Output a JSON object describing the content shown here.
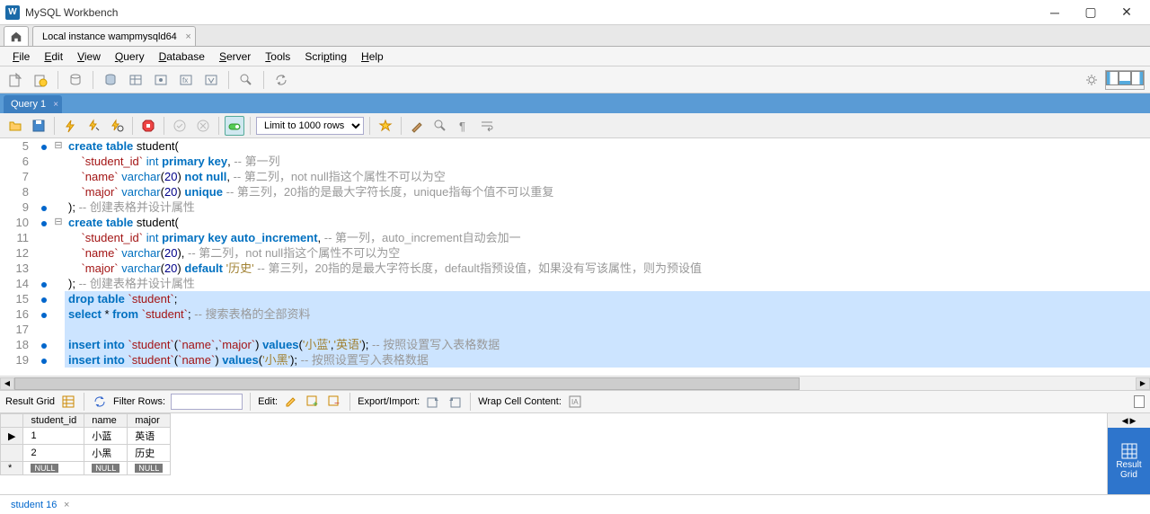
{
  "title": "MySQL Workbench",
  "connection_tab": "Local instance wampmysqld64",
  "menus": [
    "File",
    "Edit",
    "View",
    "Query",
    "Database",
    "Server",
    "Tools",
    "Scripting",
    "Help"
  ],
  "query_tab": "Query 1",
  "limit_label": "Limit to 1000 rows",
  "code": [
    {
      "n": 5,
      "marker": true,
      "fold": "⊟",
      "sel": false,
      "html": "<span class='kw'>create</span> <span class='kw'>table</span> student("
    },
    {
      "n": 6,
      "marker": false,
      "fold": "",
      "sel": false,
      "html": "    <span class='id'>`student_id`</span> <span class='fn'>int</span> <span class='kw'>primary key</span>, <span class='cmt'>-- 第一列</span>"
    },
    {
      "n": 7,
      "marker": false,
      "fold": "",
      "sel": false,
      "html": "    <span class='id'>`name`</span> <span class='fn'>varchar</span>(<span class='num'>20</span>) <span class='kw'>not null</span>, <span class='cmt'>-- 第二列，not null指这个属性不可以为空</span>"
    },
    {
      "n": 8,
      "marker": false,
      "fold": "",
      "sel": false,
      "html": "    <span class='id'>`major`</span> <span class='fn'>varchar</span>(<span class='num'>20</span>) <span class='kw'>unique</span> <span class='cmt'>-- 第三列，20指的是最大字符长度，unique指每个值不可以重复</span>"
    },
    {
      "n": 9,
      "marker": true,
      "fold": "",
      "sel": false,
      "html": "); <span class='cmt'>-- 创建表格并设计属性</span>"
    },
    {
      "n": 10,
      "marker": true,
      "fold": "⊟",
      "sel": false,
      "html": "<span class='kw'>create</span> <span class='kw'>table</span> student("
    },
    {
      "n": 11,
      "marker": false,
      "fold": "",
      "sel": false,
      "html": "    <span class='id'>`student_id`</span> <span class='fn'>int</span> <span class='kw'>primary key</span> <span class='kw'>auto_increment</span>, <span class='cmt'>-- 第一列，auto_increment自动会加一</span>"
    },
    {
      "n": 12,
      "marker": false,
      "fold": "",
      "sel": false,
      "html": "    <span class='id'>`name`</span> <span class='fn'>varchar</span>(<span class='num'>20</span>), <span class='cmt'>-- 第二列，not null指这个属性不可以为空</span>"
    },
    {
      "n": 13,
      "marker": false,
      "fold": "",
      "sel": false,
      "html": "    <span class='id'>`major`</span> <span class='fn'>varchar</span>(<span class='num'>20</span>) <span class='kw'>default</span> <span class='str'>'历史'</span> <span class='cmt'>-- 第三列，20指的是最大字符长度，default指预设值，如果没有写该属性，则为预设值</span>"
    },
    {
      "n": 14,
      "marker": true,
      "fold": "",
      "sel": false,
      "html": "); <span class='cmt'>-- 创建表格并设计属性</span>"
    },
    {
      "n": 15,
      "marker": true,
      "fold": "",
      "sel": true,
      "html": "<span class='kw'>drop</span> <span class='kw'>table</span> <span class='id'>`student`</span>;"
    },
    {
      "n": 16,
      "marker": true,
      "fold": "",
      "sel": true,
      "html": "<span class='kw'>select</span> * <span class='kw'>from</span> <span class='id'>`student`</span>; <span class='cmt'>-- 搜索表格的全部资料</span>"
    },
    {
      "n": 17,
      "marker": false,
      "fold": "",
      "sel": true,
      "html": " "
    },
    {
      "n": 18,
      "marker": true,
      "fold": "",
      "sel": true,
      "html": "<span class='kw'>insert into</span> <span class='id'>`student`</span>(<span class='id'>`name`</span>,<span class='id'>`major`</span>) <span class='kw'>values</span>(<span class='str'>'小蓝'</span>,<span class='str'>'英语'</span>); <span class='cmt'>-- 按照设置写入表格数据</span>"
    },
    {
      "n": 19,
      "marker": true,
      "fold": "",
      "sel": true,
      "html": "<span class='kw'>insert into</span> <span class='id'>`student`</span>(<span class='id'>`name`</span>) <span class='kw'>values</span>(<span class='str'>'小黑'</span>); <span class='cmt'>-- 按照设置写入表格数据</span>"
    }
  ],
  "result_toolbar": {
    "grid_label": "Result Grid",
    "filter_label": "Filter Rows:",
    "edit_label": "Edit:",
    "export_label": "Export/Import:",
    "wrap_label": "Wrap Cell Content:"
  },
  "result_side": "Result\nGrid",
  "grid": {
    "columns": [
      "student_id",
      "name",
      "major"
    ],
    "rows": [
      {
        "id": "1",
        "name": "小蓝",
        "major": "英语"
      },
      {
        "id": "2",
        "name": "小黑",
        "major": "历史"
      }
    ],
    "null_label": "NULL"
  },
  "bottom_tab": "student 16"
}
